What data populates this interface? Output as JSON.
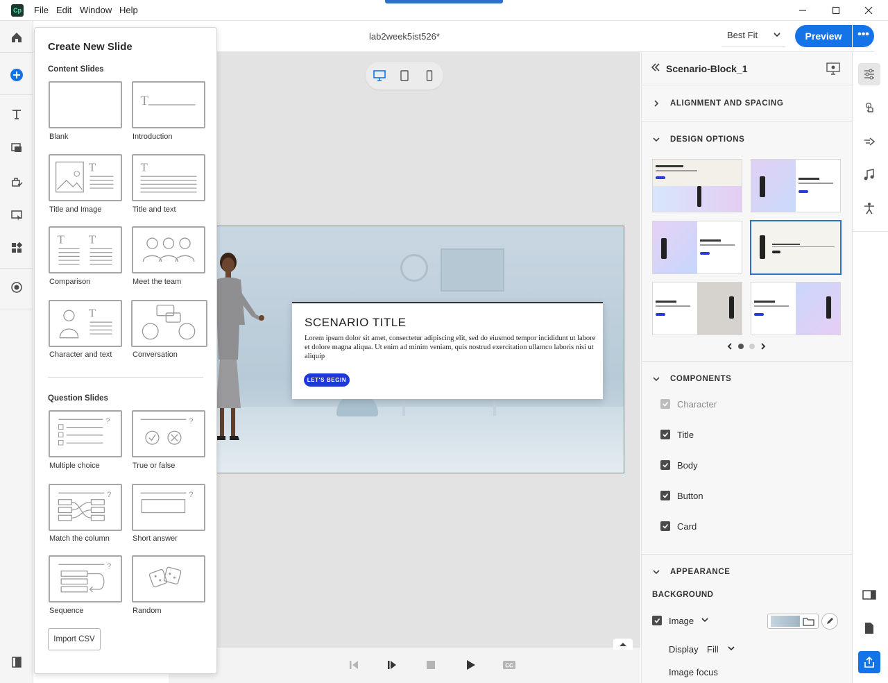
{
  "app": {
    "icon_text": "Cp",
    "doc_title": "lab2week5ist526*"
  },
  "menu": {
    "file": "File",
    "edit": "Edit",
    "window": "Window",
    "help": "Help"
  },
  "header": {
    "zoom": "Best Fit",
    "preview": "Preview",
    "more": "•••"
  },
  "popover": {
    "title": "Create New Slide",
    "content_heading": "Content Slides",
    "question_heading": "Question Slides",
    "content_slides": [
      "Blank",
      "Introduction",
      "Title and Image",
      "Title and text",
      "Comparison",
      "Meet the team",
      "Character and text",
      "Conversation"
    ],
    "question_slides": [
      "Multiple choice",
      "True or false",
      "Match the column",
      "Short answer",
      "Sequence",
      "Random"
    ],
    "import_button": "Import CSV"
  },
  "slide": {
    "title": "SCENARIO TITLE",
    "body": "Lorem ipsum dolor sit amet, consectetur adipiscing elit, sed do eiusmod tempor incididunt ut labore et dolore magna aliqua. Ut enim ad minim veniam, quis nostrud exercitation ullamco laboris nisi ut aliquip",
    "button": "LET'S BEGIN"
  },
  "panel": {
    "title": "Scenario-Block_1",
    "sections": {
      "alignment": "ALIGNMENT AND SPACING",
      "design": "DESIGN OPTIONS",
      "components": "COMPONENTS",
      "appearance": "APPEARANCE"
    },
    "components": [
      {
        "label": "Character",
        "checked": true,
        "disabled": true
      },
      {
        "label": "Title",
        "checked": true,
        "disabled": false
      },
      {
        "label": "Body",
        "checked": true,
        "disabled": false
      },
      {
        "label": "Button",
        "checked": true,
        "disabled": false
      },
      {
        "label": "Card",
        "checked": true,
        "disabled": false
      }
    ],
    "background_label": "BACKGROUND",
    "image_label": "Image",
    "display_label": "Display",
    "display_value": "Fill",
    "image_focus_label": "Image focus",
    "design_page": {
      "current": 1,
      "total": 2
    }
  },
  "colors": {
    "accent": "#1473e6",
    "slide_button": "#1d39d8",
    "selection": "#2d6fcb"
  }
}
